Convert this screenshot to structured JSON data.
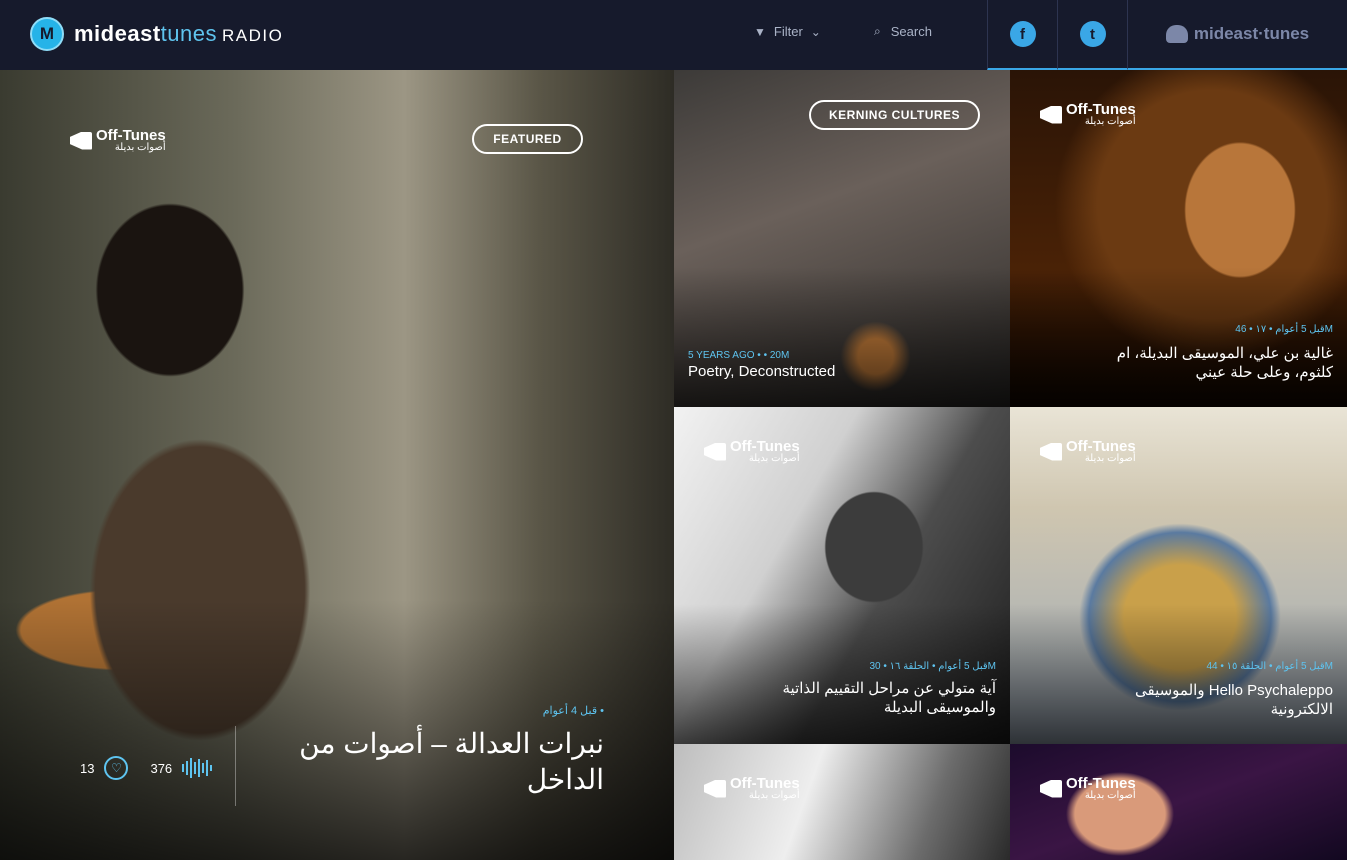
{
  "header": {
    "logo_a": "mideast",
    "logo_b": "tunes",
    "logo_c": "RADIO",
    "logo_mark": "M",
    "filter_label": "Filter",
    "search_placeholder": "Search",
    "facebook_glyph": "f",
    "twitter_glyph": "t",
    "brand_label": "mideast·tunes"
  },
  "offtunes": {
    "en": "Off-Tunes",
    "ar": "أصوات بديلة"
  },
  "featured": {
    "badge": "FEATURED",
    "meta": "قبل 4 أعوام •",
    "title": "نبرات العدالة – أصوات من الداخل",
    "likes": "13",
    "plays": "376"
  },
  "tiles": [
    {
      "badge": "KERNING CULTURES",
      "meta": "5 YEARS AGO •   • 20M",
      "title": "Poetry, Deconstructed"
    },
    {
      "meta": "قبل 5 أعوام • ١٧ • 46M",
      "title": "غالية بن علي، الموسيقى البديلة، ام كلثوم، وعلى حلة عيني"
    },
    {
      "meta": "قبل 5 أعوام • الحلقة ١٦ • 30M",
      "title": "آية متولي عن مراحل التقييم الذاتية والموسيقى البديلة"
    },
    {
      "meta": "قبل 5 أعوام • الحلقة ١٥ • 44M",
      "title": "Hello Psychaleppo والموسيقى الالكترونية"
    }
  ],
  "colors": {
    "accent": "#5ec4f0",
    "header_bg": "#161a2c",
    "divider": "#2d3450"
  }
}
